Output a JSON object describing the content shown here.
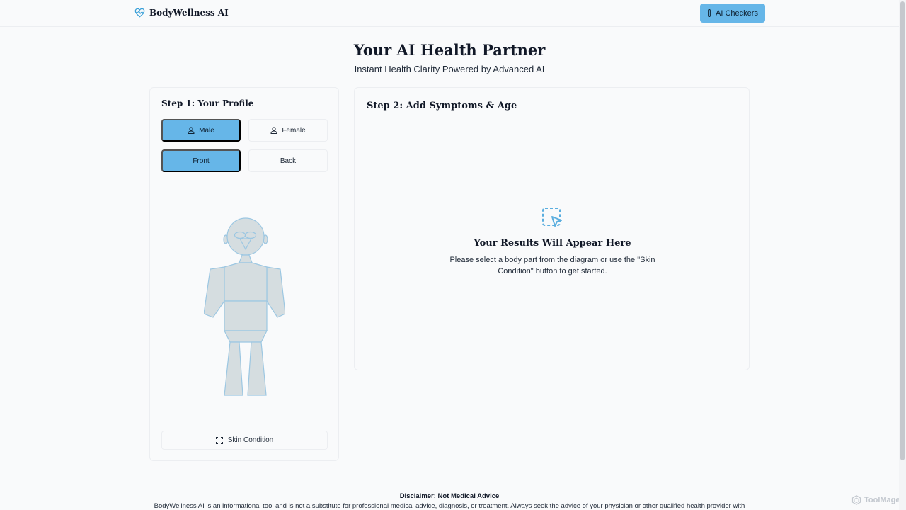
{
  "header": {
    "brand": "BodyWellness AI",
    "ai_checkers_label": "AI Checkers"
  },
  "hero": {
    "title": "Your AI Health Partner",
    "subtitle": "Instant Health Clarity Powered by Advanced AI"
  },
  "step1": {
    "title": "Step 1: Your Profile",
    "gender": {
      "options": [
        "Male",
        "Female"
      ],
      "selected": "Male"
    },
    "view": {
      "options": [
        "Front",
        "Back"
      ],
      "selected": "Front"
    },
    "skin_button": "Skin Condition"
  },
  "step2": {
    "title": "Step 2: Add Symptoms & Age",
    "results_title": "Your Results Will Appear Here",
    "results_text": "Please select a body part from the diagram or use the \"Skin Condition\" button to get started."
  },
  "disclaimer": {
    "title": "Disclaimer: Not Medical Advice",
    "text": "BodyWellness AI is an informational tool and is not a substitute for professional medical advice, diagnosis, or treatment. Always seek the advice of your physician or other qualified health provider with"
  },
  "watermark": "ToolMage",
  "colors": {
    "accent": "#66b6e8",
    "body_fill": "#d5dde0",
    "body_stroke": "#9cc7e2"
  },
  "icons": {
    "brand": "heart-pulse-icon",
    "ai_checkers": "thermometer-icon",
    "gender": "user-icon",
    "skin": "scan-frame-icon",
    "results": "dashed-pointer-icon"
  }
}
